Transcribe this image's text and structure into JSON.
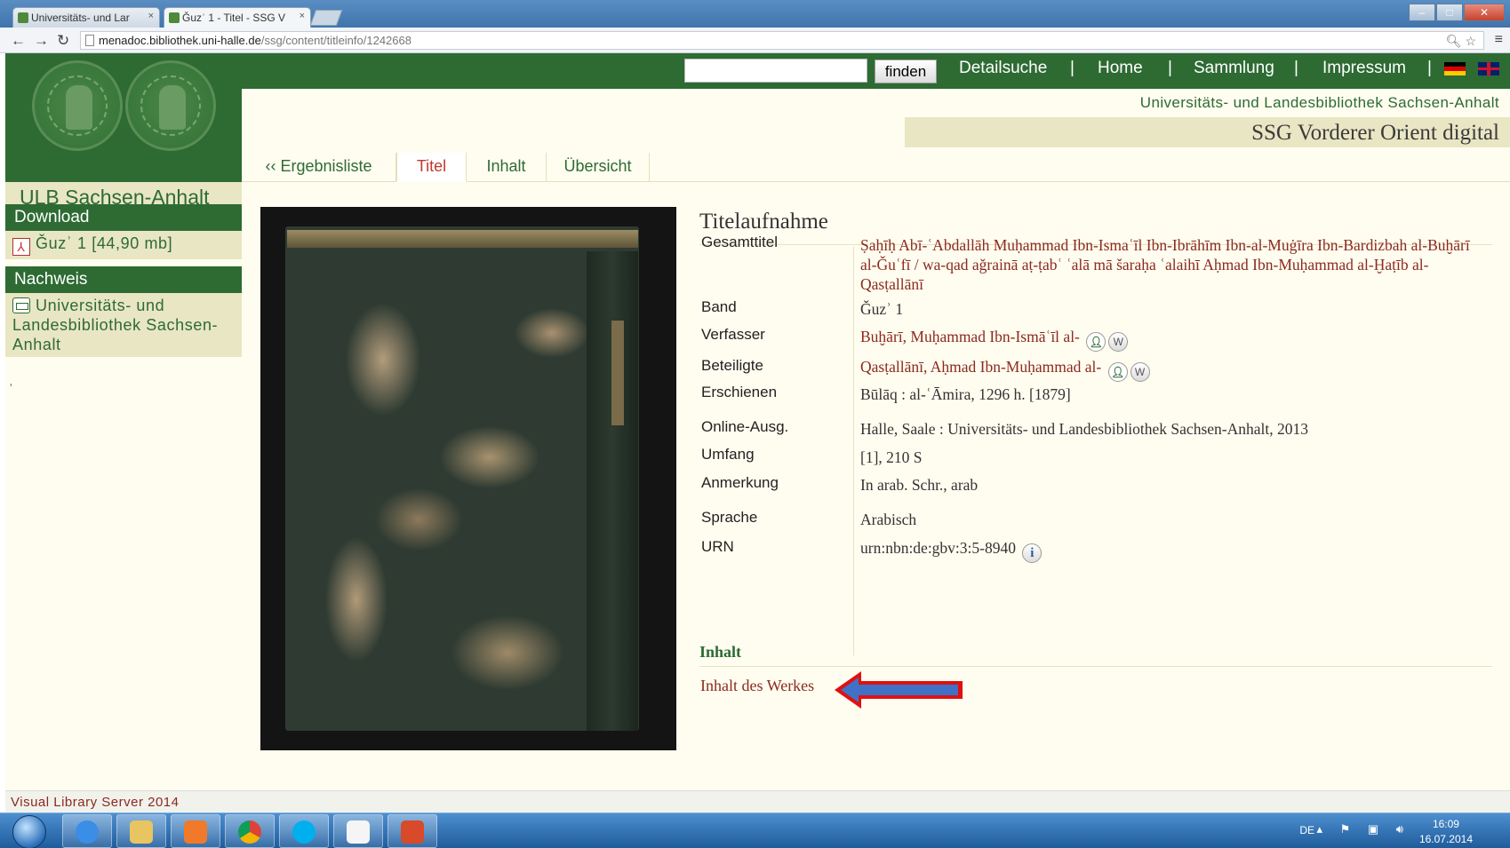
{
  "browser": {
    "tabs": [
      {
        "label": "Universitäts- und Lar",
        "active": false
      },
      {
        "label": "Ǧuzʾ 1 - Titel - SSG V",
        "active": true
      }
    ],
    "url_host": "menadoc.bibliothek.uni-halle.de",
    "url_path": "/ssg/content/titleinfo/1242668"
  },
  "header": {
    "logo_text": "ULB Sachsen-Anhalt",
    "search_placeholder": "",
    "search_button": "finden",
    "nav": [
      "Detailsuche",
      "Home",
      "Sammlung",
      "Impressum"
    ],
    "separator": "|",
    "institution": "Universitäts- und Landesbibliothek Sachsen-Anhalt",
    "portal_title": "SSG Vorderer Orient digital"
  },
  "page_tabs": [
    {
      "label": "‹‹ Ergebnisliste",
      "active": false
    },
    {
      "label": "Titel",
      "active": true
    },
    {
      "label": "Inhalt",
      "active": false
    },
    {
      "label": "Übersicht",
      "active": false
    }
  ],
  "sidebar": {
    "download_heading": "Download",
    "download_item": "Ǧuzʾ 1 [44,90 mb]",
    "nachweis_heading": "Nachweis",
    "nachweis_item": "Universitäts- und Landesbibliothek Sachsen-Anhalt",
    "tick": "ʼ"
  },
  "metadata": {
    "heading": "Titelaufnahme",
    "rows": [
      {
        "label": "Gesamttitel",
        "value": "Ṣaḥīḥ Abī-ʿAbdallāh Muḥammad Ibn-Ismaʿīl Ibn-Ibrāhīm Ibn-al-Muġīra Ibn-Bardizbah al-Buḫārī al-Ǧuʿfī / wa-qad aǧrainā aṭ-ṭabʿ ʿalā mā šaraḥa ʿalaihī Aḥmad Ibn-Muḥammad al-Ḫaṭīb al-Qasṭallānī"
      },
      {
        "label": "Band",
        "value": "Ǧuzʾ 1"
      },
      {
        "label": "Verfasser",
        "value": "Buḫārī, Muḥammad Ibn-Ismāʿīl al-"
      },
      {
        "label": "Beteiligte",
        "value": "Qasṭallānī, Aḥmad Ibn-Muḥammad al-"
      },
      {
        "label": "Erschienen",
        "value": "Būlāq : al-ʿĀmira, 1296 h. [1879]"
      },
      {
        "label": "Online-Ausg.",
        "value": "Halle, Saale : Universitäts- und Landesbibliothek Sachsen-Anhalt, 2013"
      },
      {
        "label": "Umfang",
        "value": "[1], 210 S"
      },
      {
        "label": "Anmerkung",
        "value": "In arab. Schr., arab"
      },
      {
        "label": "Sprache",
        "value": "Arabisch"
      },
      {
        "label": "URN",
        "value": "urn:nbn:de:gbv:3:5-8940"
      }
    ],
    "wiki_glyph": "W",
    "info_glyph": "i"
  },
  "contents": {
    "heading": "Inhalt",
    "link": "Inhalt des Werkes"
  },
  "footer": {
    "text": "Visual Library Server 2014"
  },
  "taskbar": {
    "lang": "DE",
    "time": "16:09",
    "date": "16.07.2014"
  },
  "colors": {
    "brand_green": "#2d6b33",
    "link_red": "#8b2a1e",
    "cream": "#fffdf0",
    "beige": "#e9e6c4",
    "arrow_blue": "#3f72c6",
    "arrow_outline": "#e01010"
  }
}
